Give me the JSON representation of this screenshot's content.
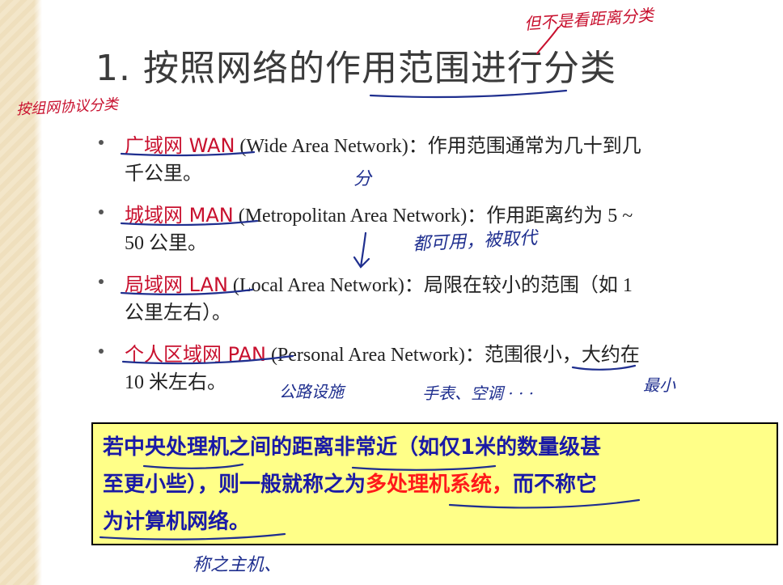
{
  "title": "1. 按照网络的作用范围进行分类",
  "items": [
    {
      "term": "广域网 WAN",
      "line1": " (Wide Area Network)：作用范围通常为几十到几",
      "line2": "千公里。"
    },
    {
      "term": "城域网 MAN",
      "line1": " (Metropolitan Area Network)：作用距离约为  5 ~",
      "line2": "50 公里。"
    },
    {
      "term": "局域网 LAN",
      "line1": " (Local Area Network)：局限在较小的范围（如 1",
      "line2": "公里左右）。"
    },
    {
      "term": "个人区域网 PAN",
      "line1": " (Personal Area Network)：范围很小，大约在",
      "line2": "10 米左右。"
    }
  ],
  "callout": {
    "line1": "若中央处理机之间的距离非常近（如仅1米的数量级甚",
    "line2_before": "至更小些），则一般就称之为",
    "line2_red": "多处理机系统，",
    "line2_after": "而不称它",
    "line3": "为计算机网络。"
  },
  "annotations": {
    "top_right": "但不是看距离分类",
    "left_margin": "按组网协议分类",
    "fen": "分",
    "replaced": "都可用，被取代",
    "facility": "公路设施",
    "devices": "手表、空调 · · ·",
    "smallest": "最小",
    "bottom": "称之主机、"
  },
  "colors": {
    "term_red": "#c8102e",
    "callout_bg": "#ffff88",
    "callout_text": "#1a1aa6",
    "callout_red": "#ff1a1a",
    "ink_blue": "#1f2f8f"
  }
}
